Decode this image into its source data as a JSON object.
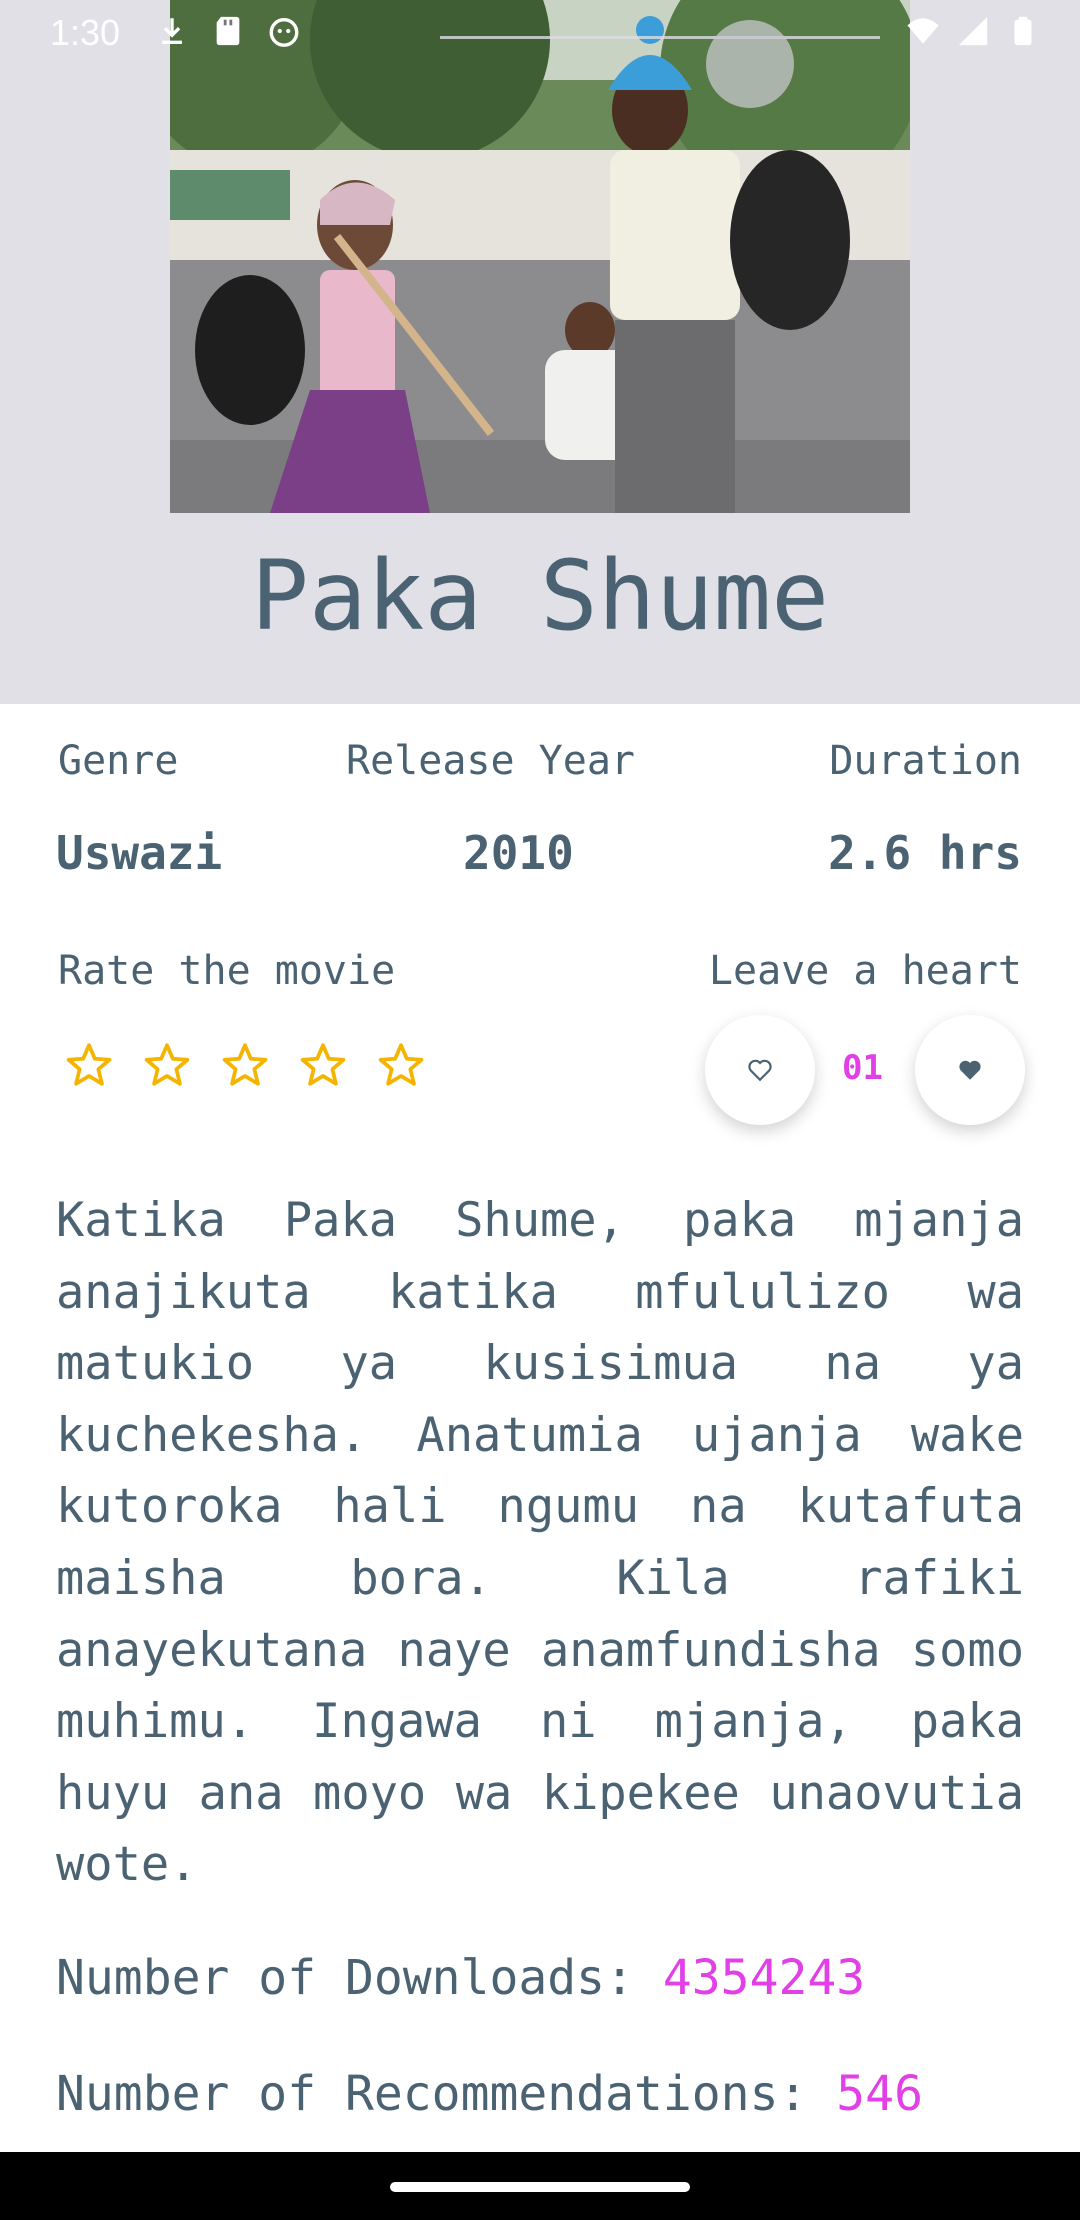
{
  "status_bar": {
    "time": "1:30",
    "left_icons": [
      "download-icon",
      "sd-card-icon",
      "android-head-icon"
    ],
    "right_icons": [
      "wifi-icon",
      "cell-signal-icon",
      "battery-icon"
    ]
  },
  "movie": {
    "title": "Paka Shume",
    "poster_icon": "movie-poster-image"
  },
  "info": {
    "genre_label": "Genre",
    "genre_value": "Uswazi",
    "year_label": "Release Year",
    "year_value": "2010",
    "duration_label": "Duration",
    "duration_value": "2.6 hrs"
  },
  "rating": {
    "label": "Rate the movie",
    "stars_total": 5,
    "stars_filled": 0,
    "star_color": "#f5b400"
  },
  "heart": {
    "label": "Leave a heart",
    "count": "01",
    "count_color": "#e040e6"
  },
  "description": "Katika Paka Shume, paka mjanja anajikuta katika mfululizo wa matukio ya kusisimua na ya kuchekesha. Anatumia ujanja wake kutoroka hali ngumu na kutafuta maisha bora. Kila rafiki anayekutana naye anamfundisha somo muhimu. Ingawa ni mjanja, paka huyu ana moyo wa kipekee unaovutia wote.",
  "stats": {
    "downloads_label": "Number of Downloads: ",
    "downloads_value": "4354243",
    "recommendations_label": "Number of Recommendations: ",
    "recommendations_value": "546"
  },
  "colors": {
    "text": "#4a6272",
    "accent": "#e040e6",
    "header_bg": "#e0e0e6"
  }
}
